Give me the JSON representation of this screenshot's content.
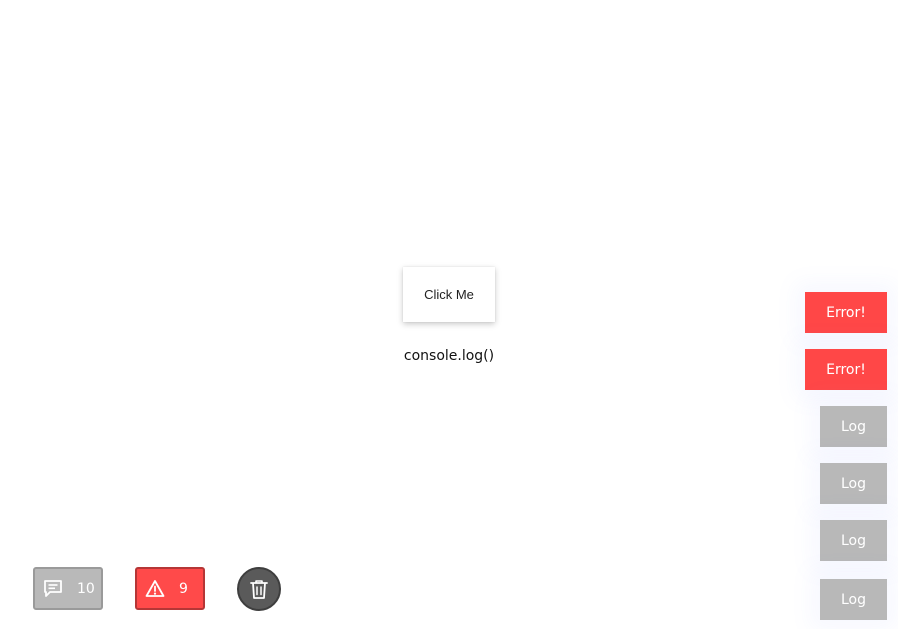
{
  "main": {
    "click_button_label": "Click Me",
    "console_caption": "console.log()"
  },
  "toasts": [
    {
      "type": "error",
      "label": "Error!"
    },
    {
      "type": "error",
      "label": "Error!"
    },
    {
      "type": "log",
      "label": "Log"
    },
    {
      "type": "log",
      "label": "Log"
    },
    {
      "type": "log",
      "label": "Log"
    },
    {
      "type": "log",
      "label": "Log"
    }
  ],
  "bottom_bar": {
    "logs_counter": {
      "icon": "message-icon",
      "count": "10"
    },
    "errors_counter": {
      "icon": "warning-icon",
      "count": "9"
    },
    "clear_button": {
      "icon": "trash-icon"
    }
  },
  "colors": {
    "error": "#ff4747",
    "log": "#b8b8b8",
    "clear": "#5a5a5a"
  }
}
